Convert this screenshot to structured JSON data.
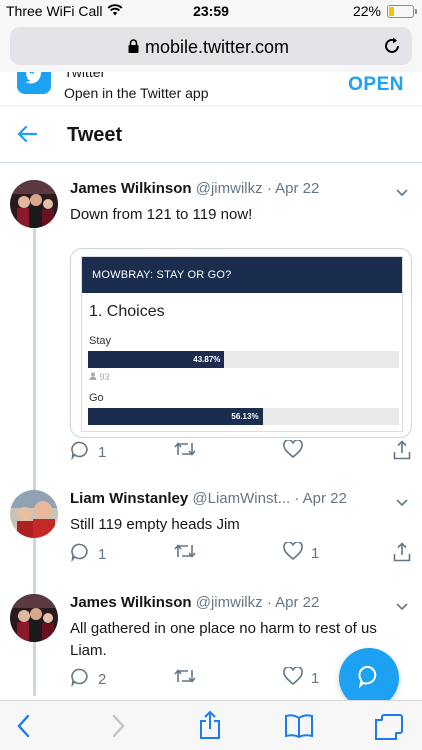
{
  "status": {
    "carrier": "Three WiFi Call",
    "time": "23:59",
    "battery": "22%",
    "battery_level": 0.22
  },
  "browser": {
    "url": "mobile.twitter.com"
  },
  "banner": {
    "app_name": "Twitter",
    "subtitle": "Open in the Twitter app",
    "open_label": "OPEN"
  },
  "header": {
    "title": "Tweet"
  },
  "tweets": [
    {
      "name": "James Wilkinson",
      "handle": "@jimwilkz",
      "separator": "·",
      "date": "Apr 22",
      "text": "Down from 121 to 119 now!",
      "replies": "1",
      "retweets": "",
      "likes": ""
    },
    {
      "name": "Liam Winstanley",
      "handle": "@LiamWinst...",
      "separator": "·",
      "date": "Apr 22",
      "text": "Still 119 empty heads Jim",
      "replies": "1",
      "retweets": "",
      "likes": "1"
    },
    {
      "name": "James Wilkinson",
      "handle": "@jimwilkz",
      "separator": "·",
      "date": "Apr 22",
      "text": "All gathered in one place no harm to rest of us Liam.",
      "replies": "2",
      "retweets": "",
      "likes": "1"
    }
  ],
  "poll": {
    "header": "MOWBRAY: STAY OR GO?",
    "question": "1. Choices",
    "options": [
      {
        "label": "Stay",
        "percent_label": "43.87%",
        "percent": 43.87,
        "votes": "93"
      },
      {
        "label": "Go",
        "percent_label": "56.13%",
        "percent": 56.13
      }
    ]
  },
  "colors": {
    "accent": "#1da1f2",
    "poll_navy": "#1b2d4f",
    "muted": "#657786"
  }
}
